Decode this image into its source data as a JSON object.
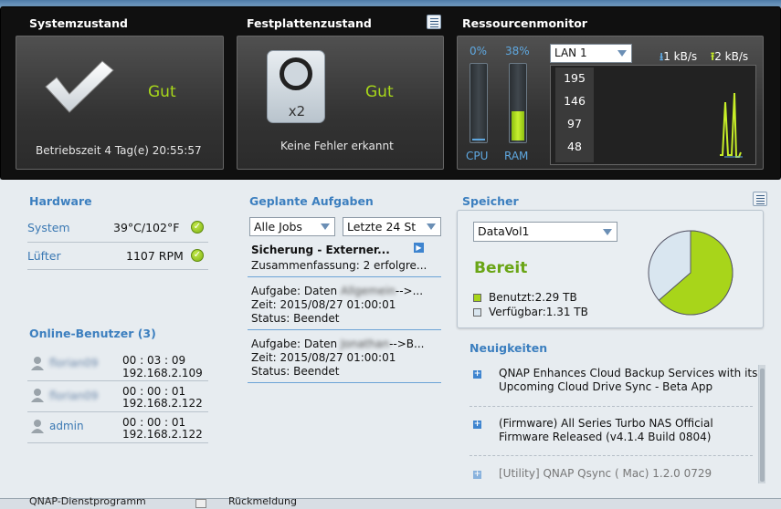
{
  "system": {
    "title": "Systemzustand",
    "status": "Gut",
    "uptime": "Betriebszeit 4 Tag(e) 20:55:57"
  },
  "disk": {
    "title": "Festplattenzustand",
    "count": "x2",
    "status": "Gut",
    "message": "Keine Fehler erkannt"
  },
  "resource": {
    "title": "Ressourcenmonitor",
    "cpu_percent": "0%",
    "ram_percent": "38%",
    "cpu_label": "CPU",
    "ram_label": "RAM",
    "cpu_level": 0.02,
    "ram_level": 0.38,
    "lan_select": "LAN 1",
    "download": "1 kB/s",
    "upload": "2 kB/s",
    "graph_ticks": [
      "195",
      "146",
      "97",
      "48"
    ]
  },
  "hardware": {
    "title": "Hardware",
    "rows": [
      {
        "label": "System",
        "value": "39°C/102°F"
      },
      {
        "label": "Lüfter",
        "value": "1107 RPM"
      }
    ]
  },
  "online": {
    "title": "Online-Benutzer (3)",
    "users": [
      {
        "name": "florian09",
        "time": "00 : 03 : 09",
        "ip": "192.168.2.109"
      },
      {
        "name": "florian09",
        "time": "00 : 00 : 01",
        "ip": "192.168.2.122"
      },
      {
        "name": "admin",
        "time": "00 : 00 : 01",
        "ip": "192.168.2.122"
      }
    ]
  },
  "tasks": {
    "title": "Geplante Aufgaben",
    "filter_jobs": "Alle Jobs",
    "filter_time": "Letzte 24 St",
    "heading": "Sicherung - Externer...",
    "summary": "Zusammenfassung: 2 erfolgre...",
    "entries": [
      {
        "task_prefix": "Aufgabe: Daten",
        "task_blur": "Allgemein",
        "task_suffix": "-->...",
        "time": "Zeit: 2015/08/27 01:00:01",
        "status": "Status: Beendet"
      },
      {
        "task_prefix": "Aufgabe: Daten",
        "task_blur": "Jonathan",
        "task_suffix": "-->B...",
        "time": "Zeit: 2015/08/27 01:00:01",
        "status": "Status: Beendet"
      }
    ]
  },
  "storage": {
    "title": "Speicher",
    "volume": "DataVol1",
    "status": "Bereit",
    "used": "Benutzt:2.29 TB",
    "free": "Verfügbar:1.31 TB",
    "used_fraction": 0.636,
    "used_color": "#a8d51a",
    "free_color": "#d9e6f0"
  },
  "news": {
    "title": "Neuigkeiten",
    "items": [
      {
        "line1": "QNAP Enhances Cloud Backup Services with its",
        "line2": "Upcoming Cloud Drive Sync - Beta App"
      },
      {
        "line1": "(Firmware) All Series Turbo NAS Official",
        "line2": "Firmware Released (v4.1.4 Build 0804)"
      },
      {
        "line1": "[Utility] QNAP Qsync ( Mac) 1.2.0 0729",
        "line2": ""
      }
    ]
  },
  "taskbar": {
    "item1": "QNAP-Dienstprogramm",
    "item2": "Rückmeldung"
  }
}
